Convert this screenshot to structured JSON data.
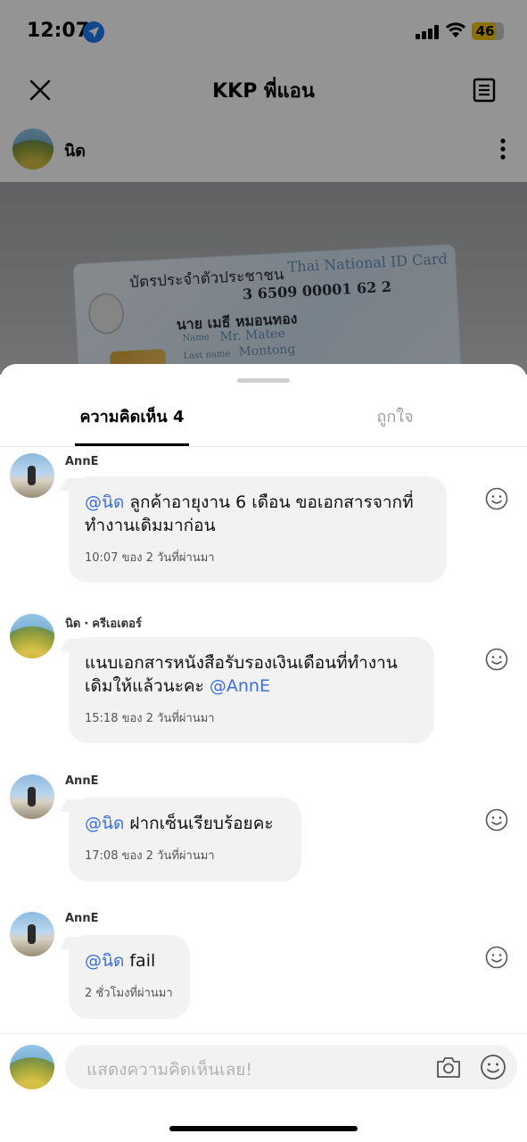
{
  "status_bar": {
    "time": "12:07",
    "battery": "46"
  },
  "post": {
    "title": "KKP พี่แอน",
    "author": "นิด",
    "id_card": {
      "th_title": "บัตรประจำตัวประชาชน",
      "en_title": "Thai National ID Card",
      "id_number": "3 6509 00001 62 2",
      "name_th": "นาย เมธี  หมอนทอง",
      "name_label": "Name",
      "name_en": "Mr. Matee",
      "lastname_label": "Last name",
      "lastname_en": "Montong"
    }
  },
  "tabs": {
    "comments": "ความคิดเห็น 4",
    "likes": "ถูกใจ"
  },
  "comments": [
    {
      "author": "AnnE",
      "mention": "@นิด",
      "text": " ลูกค้าอายุงาน 6 เดือน ขอเอกสารจากที่ทำงานเดิมมาก่อน",
      "meta": "10:07 ของ 2 วันที่ผ่านมา"
    },
    {
      "author": "นิด",
      "badge": "ครีเอเตอร์",
      "text": "แนบเอกสารหนังสือรับรองเงินเดือนที่ทำงานเดิมให้แล้วนะคะ ",
      "mention": "@AnnE",
      "meta": "15:18 ของ 2 วันที่ผ่านมา"
    },
    {
      "author": "AnnE",
      "mention": "@นิด",
      "text": " ฝากเซ็นเรียบร้อยคะ",
      "meta": "17:08 ของ 2 วันที่ผ่านมา"
    },
    {
      "author": "AnnE",
      "mention": "@นิด",
      "text": " fail",
      "meta": "2 ชั่วโมงที่ผ่านมา"
    }
  ],
  "input": {
    "placeholder": "แสดงความคิดเห็นเลย!"
  },
  "icons": {
    "close": "close-icon",
    "notes": "document-icon",
    "more": "more-vertical-icon",
    "location": "location-arrow-icon",
    "react": "smiley-icon",
    "camera": "camera-icon",
    "emoji": "smiley-icon"
  },
  "colors": {
    "mention": "#3b6fe0",
    "bubble": "#f2f2f2",
    "battery": "#f5c400",
    "location": "#1e7bf0"
  }
}
